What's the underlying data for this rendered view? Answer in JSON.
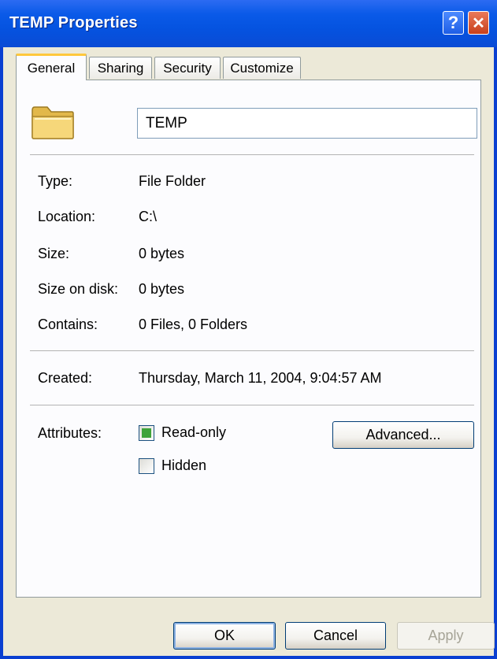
{
  "window": {
    "title": "TEMP Properties",
    "help_glyph": "?",
    "close_glyph": "✕"
  },
  "tabs": [
    {
      "label": "General",
      "active": true
    },
    {
      "label": "Sharing",
      "active": false
    },
    {
      "label": "Security",
      "active": false
    },
    {
      "label": "Customize",
      "active": false
    }
  ],
  "general": {
    "folder_name": "TEMP",
    "icon": "folder-icon",
    "properties": {
      "type": {
        "label": "Type:",
        "value": "File Folder"
      },
      "location": {
        "label": "Location:",
        "value": "C:\\"
      },
      "size": {
        "label": "Size:",
        "value": "0 bytes"
      },
      "size_on_disk": {
        "label": "Size on disk:",
        "value": "0 bytes"
      },
      "contains": {
        "label": "Contains:",
        "value": "0 Files, 0 Folders"
      },
      "created": {
        "label": "Created:",
        "value": "Thursday, March 11, 2004, 9:04:57 AM"
      }
    },
    "attributes": {
      "label": "Attributes:",
      "read_only": {
        "label": "Read-only",
        "checked": true
      },
      "hidden": {
        "label": "Hidden",
        "checked": false
      },
      "advanced_label": "Advanced..."
    }
  },
  "buttons": {
    "ok": "OK",
    "cancel": "Cancel",
    "apply": "Apply"
  },
  "colors": {
    "titlebar": "#0553E0",
    "face": "#ECE9D8",
    "panel": "#FCFCFE",
    "tab_highlight": "#FFC83C",
    "checkbox_fill": "#3FA33A"
  }
}
